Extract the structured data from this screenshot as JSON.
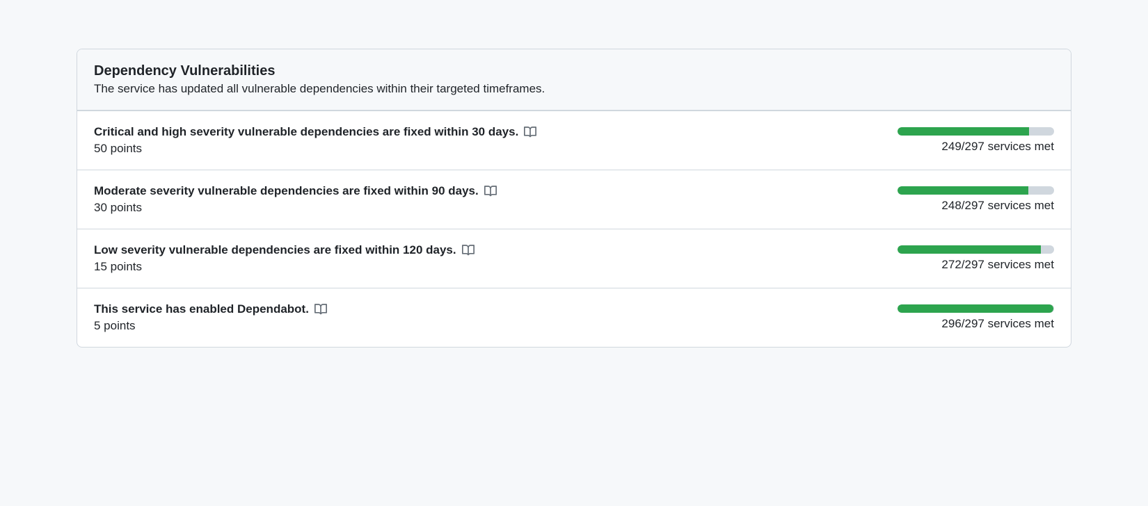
{
  "panel": {
    "title": "Dependency Vulnerabilities",
    "subtitle": "The service has updated all vulnerable dependencies within their targeted timeframes."
  },
  "colors": {
    "progress_fill": "#2da44e",
    "progress_track": "#d0d7de",
    "border": "#d0d7de"
  },
  "items": [
    {
      "title": "Critical and high severity vulnerable dependencies are fixed within 30 days.",
      "points_label": "50 points",
      "points": 50,
      "met": 249,
      "total": 297,
      "services_met_label": "249/297 services met"
    },
    {
      "title": "Moderate severity vulnerable dependencies are fixed within 90 days.",
      "points_label": "30 points",
      "points": 30,
      "met": 248,
      "total": 297,
      "services_met_label": "248/297 services met"
    },
    {
      "title": "Low severity vulnerable dependencies are fixed within 120 days.",
      "points_label": "15 points",
      "points": 15,
      "met": 272,
      "total": 297,
      "services_met_label": "272/297 services met"
    },
    {
      "title": "This service has enabled Dependabot.",
      "points_label": "5 points",
      "points": 5,
      "met": 296,
      "total": 297,
      "services_met_label": "296/297 services met"
    }
  ]
}
